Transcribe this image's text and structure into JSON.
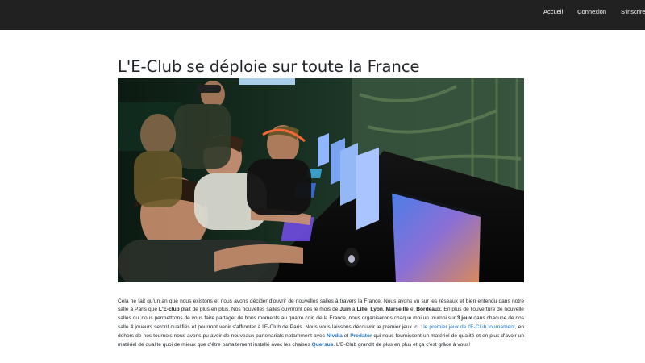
{
  "nav": {
    "items": [
      "Accueil",
      "Connexion",
      "S'inscrire"
    ]
  },
  "article": {
    "title": "L'E-Club se déploie sur toute la France",
    "image_description": "Joueurs concentrés devant des écrans dans une salle e-sport éclairée au néon",
    "p_1": "Cela ne fait qu'un an que nous existons et nous avons décider d'ouvrir de nouvelles salles à travers la France. Nous avons vu sur les réseaux et bien entendu dans notre salle à Paris que ",
    "b_eclub": "L'E-club",
    "p_2": " plait de plus en plus. Nos nouvelles salles ouvriront dès le mois de ",
    "b_juin": "Juin",
    "p_3": " à ",
    "b_lille": "Lille",
    "p_4": ", ",
    "b_lyon": "Lyon",
    "p_5": ", ",
    "b_marseille": "Marseille",
    "p_6": " et ",
    "b_bordeaux": "Bordeaux",
    "p_7": ". En plus de l'ouverture de nouvelle salles qui nous permettrons de vous faire partager de bons moments au quatre coin de la France, nous organiserons chaque moi un tournoi sur ",
    "b_3jeux": "3 jeux",
    "p_8": " dans chacune de nos salle 4 joueurs seront qualifiés et pourront venir s'affronter à l'E-Club de Paris. Nous vous laissons découvrir le premier jeux ici : ",
    "link_tournament": "le premier jeux de l'E-Club tournament",
    "p_9": ", en dehors de nos tournois nous avons pu avoir de nouveaux partenariats notamment avec ",
    "link_nivdia": "Nivdia",
    "p_10": " et ",
    "link_predator": "Predator",
    "p_11": " qui nous fournissent un matériel de qualité et en plus d'avoir un matériel de qualité quoi de mieux que d'être parfaitement installé avec les chaises ",
    "link_quersus": "Quersus",
    "p_12": ". L'E-Club grandit de plus en plus et ça c'est grâce à vous!"
  },
  "colors": {
    "navbar_bg": "#212121",
    "link": "#1a73c8",
    "text": "#212529"
  }
}
